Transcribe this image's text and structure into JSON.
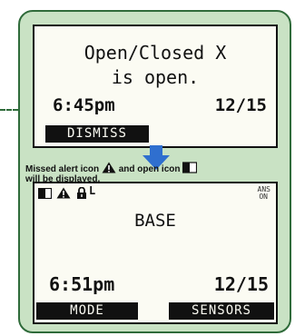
{
  "top_screen": {
    "message_line1": "Open/Closed X",
    "message_line2": "is open.",
    "time": "6:45pm",
    "date": "12/15",
    "softkey": "DISMISS"
  },
  "note": {
    "line1_before": "Missed alert icon",
    "line1_middle": "and open icon",
    "line2": "will be displayed."
  },
  "bottom_screen": {
    "status_icons": [
      "open-icon",
      "alert-icon",
      "lock-icon"
    ],
    "lock_suffix": "L",
    "ans_line1": "ANS",
    "ans_line2": "ON",
    "mode_text": "BASE",
    "time": "6:51pm",
    "date": "12/15",
    "softkey_left": "MODE",
    "softkey_right": "SENSORS"
  },
  "colors": {
    "card_fill": "#c9e2c4",
    "card_border": "#2f6b3a",
    "arrow": "#2f6fcf",
    "lcd_background": "#fbfbf3"
  }
}
